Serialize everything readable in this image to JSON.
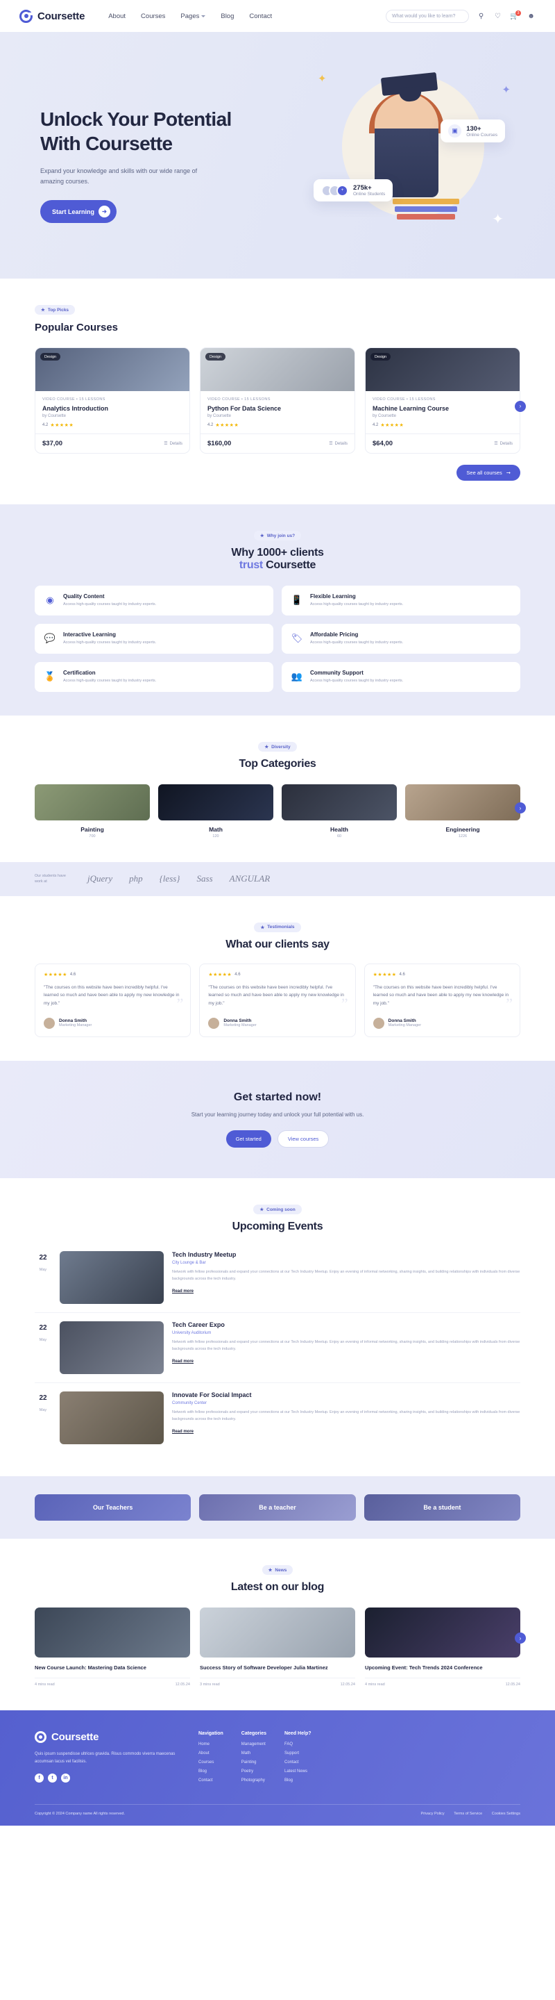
{
  "header": {
    "brand": "Coursette",
    "nav": [
      {
        "label": "About",
        "caret": false
      },
      {
        "label": "Courses",
        "caret": false
      },
      {
        "label": "Pages",
        "caret": true
      },
      {
        "label": "Blog",
        "caret": false
      },
      {
        "label": "Contact",
        "caret": false
      }
    ],
    "search_placeholder": "What would you like to learn?",
    "cart_count": "3"
  },
  "hero": {
    "title_line1": "Unlock Your Potential",
    "title_line2": "With Coursette",
    "subtitle": "Expand your knowledge and skills with our wide range of amazing courses.",
    "cta": "Start Learning",
    "badge_courses_number": "130+",
    "badge_courses_label": "Online Courses",
    "badge_students_number": "275k+",
    "badge_students_label": "Online Students"
  },
  "popular": {
    "pill": "Top Picks",
    "title": "Popular Courses",
    "all_button": "See all courses",
    "courses": [
      {
        "tag": "Design",
        "meta": "VIDEO COURSE  •  15 LESSONS",
        "title": "Analytics Introduction",
        "by": "by Coursette",
        "rating": "4.2",
        "price": "$37,00",
        "details": "Details"
      },
      {
        "tag": "Design",
        "meta": "VIDEO COURSE  •  15 LESSONS",
        "title": "Python For Data Science",
        "by": "by Coursette",
        "rating": "4.2",
        "price": "$160,00",
        "details": "Details"
      },
      {
        "tag": "Design",
        "meta": "VIDEO COURSE  •  15 LESSONS",
        "title": "Machine Learning Course",
        "by": "by Coursette",
        "rating": "4.2",
        "price": "$64,00",
        "details": "Details"
      }
    ]
  },
  "why": {
    "pill": "Why join us?",
    "title_line1": "Why 1000+ clients",
    "title_accent": "trust",
    "title_rest": "Coursette",
    "features": [
      {
        "icon": "eye-icon",
        "title": "Quality Content",
        "desc": "Access high-quality courses taught by industry experts."
      },
      {
        "icon": "mobile-icon",
        "title": "Flexible Learning",
        "desc": "Access high-quality courses taught by industry experts."
      },
      {
        "icon": "chat-icon",
        "title": "Interactive Learning",
        "desc": "Access high-quality courses taught by industry experts."
      },
      {
        "icon": "price-tag-icon",
        "title": "Affordable Pricing",
        "desc": "Access high-quality courses taught by industry experts."
      },
      {
        "icon": "medal-icon",
        "title": "Certification",
        "desc": "Access high-quality courses taught by industry experts."
      },
      {
        "icon": "people-icon",
        "title": "Community Support",
        "desc": "Access high-quality courses taught by industry experts."
      }
    ]
  },
  "categories": {
    "pill": "Diversity",
    "title": "Top Categories",
    "items": [
      {
        "name": "Painting",
        "count": "700"
      },
      {
        "name": "Math",
        "count": "120"
      },
      {
        "name": "Health",
        "count": "60"
      },
      {
        "name": "Engineering",
        "count": "1226"
      }
    ]
  },
  "brands": {
    "label": "Our students have work at",
    "logos": [
      "jQuery",
      "php",
      "{less}",
      "Sass",
      "ANGULAR"
    ]
  },
  "testimonials": {
    "pill": "Testimonials",
    "title": "What our clients say",
    "items": [
      {
        "rating": "4.6",
        "quote": "\"The courses on this website have been incredibly helpful. I've learned so much and have been able to apply my new knowledge in my job.\"",
        "name": "Donna Smith",
        "role": "Marketing Manager"
      },
      {
        "rating": "4.6",
        "quote": "\"The courses on this website have been incredibly helpful. I've learned so much and have been able to apply my new knowledge in my job.\"",
        "name": "Donna Smith",
        "role": "Marketing Manager"
      },
      {
        "rating": "4.6",
        "quote": "\"The courses on this website have been incredibly helpful. I've learned so much and have been able to apply my new knowledge in my job.\"",
        "name": "Donna Smith",
        "role": "Marketing Manager"
      }
    ]
  },
  "cta": {
    "title": "Get started now!",
    "subtitle": "Start your learning journey today and unlock your full potential with us.",
    "primary": "Get started",
    "secondary": "View courses"
  },
  "events": {
    "pill": "Coming soon",
    "title": "Upcoming Events",
    "items": [
      {
        "day": "22",
        "month": "May",
        "title": "Tech Industry Meetup",
        "location": "City Lounge & Bar",
        "desc": "Network with fellow professionals and expand your connections at our Tech Industry Meetup. Enjoy an evening of informal networking, sharing insights, and building relationships with individuals from diverse backgrounds across the tech industry.",
        "read": "Read more"
      },
      {
        "day": "22",
        "month": "May",
        "title": "Tech Career Expo",
        "location": "University Auditorium",
        "desc": "Network with fellow professionals and expand your connections at our Tech Industry Meetup. Enjoy an evening of informal networking, sharing insights, and building relationships with individuals from diverse backgrounds across the tech industry.",
        "read": "Read more"
      },
      {
        "day": "22",
        "month": "May",
        "title": "Innovate For Social Impact",
        "location": "Community Center",
        "desc": "Network with fellow professionals and expand your connections at our Tech Industry Meetup. Enjoy an evening of informal networking, sharing insights, and building relationships with individuals from diverse backgrounds across the tech industry.",
        "read": "Read more"
      }
    ]
  },
  "band": {
    "cards": [
      "Our Teachers",
      "Be a teacher",
      "Be a student"
    ]
  },
  "blog": {
    "pill": "News",
    "title": "Latest on our blog",
    "posts": [
      {
        "title": "New Course Launch: Mastering Data Science",
        "time": "4 mins read",
        "date": "12.05.24"
      },
      {
        "title": "Success Story of Software Developer Julia Martinez",
        "time": "3 mins read",
        "date": "12.05.24"
      },
      {
        "title": "Upcoming Event: Tech Trends 2024 Conference",
        "time": "4 mins read",
        "date": "12.05.24"
      }
    ]
  },
  "footer": {
    "brand": "Coursette",
    "desc": "Quis ipsum suspendisse ultrices gravida. Risus commodo viverra maecenas accumsan lacus vel facilisis.",
    "socials": [
      "facebook-icon",
      "twitter-icon",
      "linkedin-icon"
    ],
    "columns": [
      {
        "heading": "Navigation",
        "links": [
          "Home",
          "About",
          "Courses",
          "Blog",
          "Contact"
        ]
      },
      {
        "heading": "Categories",
        "links": [
          "Management",
          "Math",
          "Painting",
          "Poetry",
          "Photography"
        ]
      },
      {
        "heading": "Need Help?",
        "links": [
          "FAQ",
          "Support",
          "Contact",
          "Latest News",
          "Blog"
        ]
      }
    ],
    "copyright": "Copyright © 2024 Company name All rights reserved.",
    "legal": [
      "Privacy Policy",
      "Terms of Service",
      "Cookies Settings"
    ]
  }
}
